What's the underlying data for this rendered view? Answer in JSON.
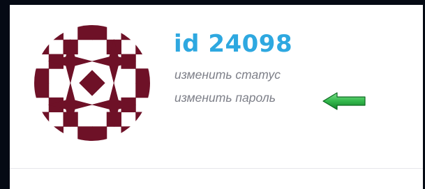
{
  "profile": {
    "id_text": "id 24098",
    "links": {
      "change_status": "изменить статус",
      "change_password": "изменить пароль"
    }
  },
  "avatar": {
    "icon": "identicon-star-pattern",
    "color": "#6e1127"
  },
  "annotation": {
    "icon": "green-arrow-left",
    "color": "#2fb34a"
  },
  "colors": {
    "id_text": "#2ea8e0",
    "link_text": "#7d7f88",
    "divider": "#e6e6ea",
    "outer_background": "#050a14",
    "card_background": "#ffffff"
  }
}
